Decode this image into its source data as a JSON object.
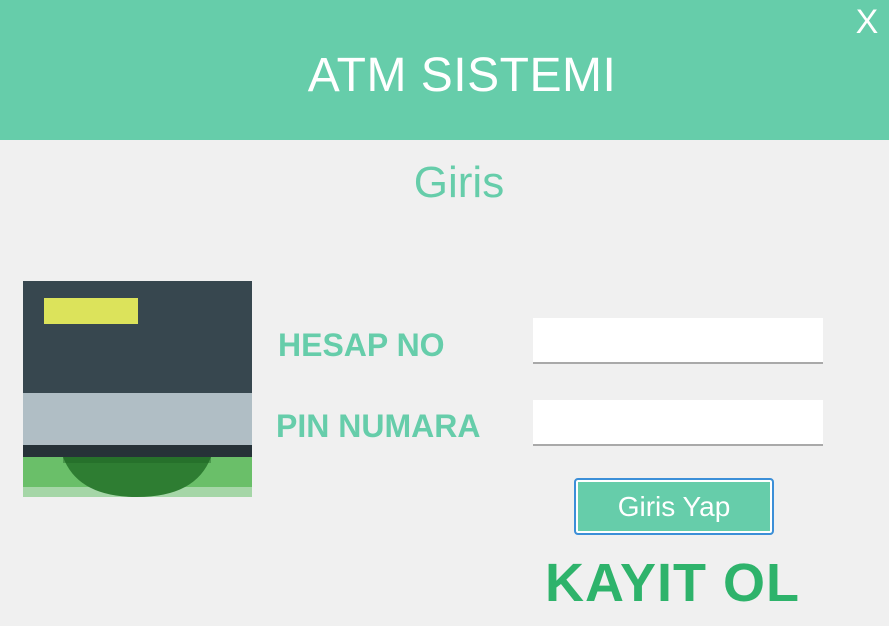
{
  "window": {
    "title": "ATM SISTEMI",
    "close_label": "X"
  },
  "login": {
    "heading": "Giris",
    "account_label": "HESAP NO",
    "account_value": "",
    "pin_label": "PIN NUMARA",
    "pin_value": "",
    "submit_label": "Giris Yap",
    "register_label": "KAYIT OL"
  },
  "colors": {
    "accent": "#66cdaa",
    "register": "#2eb36b",
    "button_border": "#3c8fd8",
    "background": "#f0f0f0"
  },
  "icons": {
    "atm": "atm-cash-icon"
  }
}
